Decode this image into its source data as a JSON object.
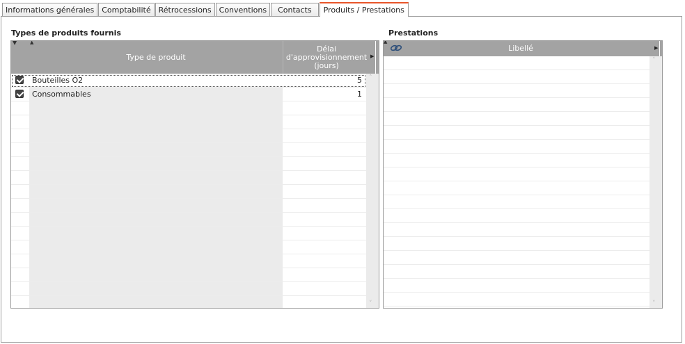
{
  "tabs": [
    {
      "label": "Informations générales",
      "active": false
    },
    {
      "label": "Comptabilité",
      "active": false
    },
    {
      "label": "Rétrocessions",
      "active": false
    },
    {
      "label": "Conventions",
      "active": false
    },
    {
      "label": "Contacts",
      "active": false
    },
    {
      "label": "Produits / Prestations",
      "active": true
    }
  ],
  "left_section": {
    "title": "Types de produits fournis",
    "columns": {
      "type": "Type de produit",
      "delay": "Délai d'approvisionnement (jours)"
    },
    "rows": [
      {
        "checked": true,
        "type": "Bouteilles O2",
        "delay": "5"
      },
      {
        "checked": true,
        "type": "Consommables",
        "delay": "1"
      }
    ]
  },
  "right_section": {
    "title": "Prestations",
    "columns": {
      "libelle": "Libellé"
    },
    "rows": []
  },
  "colors": {
    "active_tab_accent": "#e8552a",
    "header_bg": "#a3a3a3",
    "zebra_bg": "#ebebeb"
  }
}
